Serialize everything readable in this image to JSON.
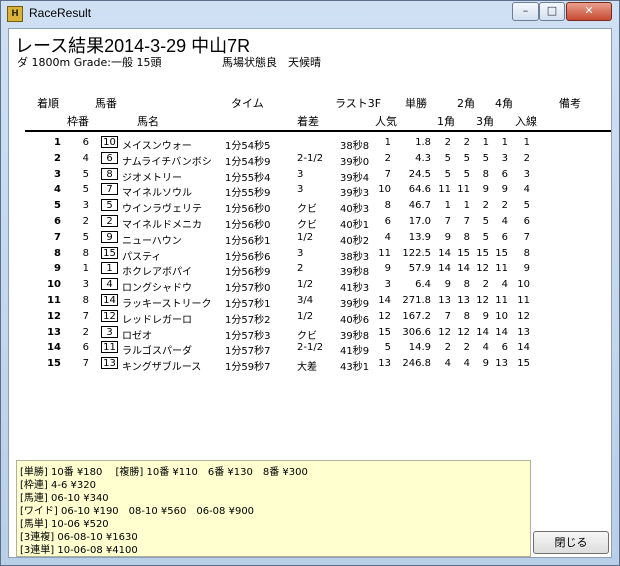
{
  "window": {
    "title": "RaceResult",
    "minimize": "–",
    "maximize": "□",
    "close": "✕"
  },
  "header": {
    "title": "レース結果2014-3-29 中山7R",
    "course": "ダ 1800m Grade:一般 15頭",
    "condition": "馬場状態良　天候晴"
  },
  "columns": {
    "chakujun": "着順",
    "umaban": "馬番",
    "time": "タイム",
    "last3f": "ラスト3F",
    "tansho": "単勝",
    "corner2": "2角",
    "corner4": "4角",
    "biko": "備考",
    "wakuban": "枠番",
    "bamei": "馬名",
    "chakusa": "着差",
    "ninki": "人気",
    "corner1": "1角",
    "corner3": "3角",
    "nyusen": "入線"
  },
  "rows": [
    {
      "pos": "1",
      "waku": "6",
      "num": "10",
      "name": "メイスンウォー",
      "time": "1分54秒5",
      "margin": "",
      "l3f": "38秒8",
      "pop": "1",
      "odds": "1.8",
      "c1": "2",
      "c2": "2",
      "c3": "1",
      "c4": "1",
      "fin": "1"
    },
    {
      "pos": "2",
      "waku": "4",
      "num": "6",
      "name": "ナムライチバンボシ",
      "time": "1分54秒9",
      "margin": "2-1/2",
      "l3f": "39秒0",
      "pop": "2",
      "odds": "4.3",
      "c1": "5",
      "c2": "5",
      "c3": "5",
      "c4": "3",
      "fin": "2"
    },
    {
      "pos": "3",
      "waku": "5",
      "num": "8",
      "name": "ジオメトリー",
      "time": "1分55秒4",
      "margin": "3",
      "l3f": "39秒4",
      "pop": "7",
      "odds": "24.5",
      "c1": "5",
      "c2": "5",
      "c3": "8",
      "c4": "6",
      "fin": "3"
    },
    {
      "pos": "4",
      "waku": "5",
      "num": "7",
      "name": "マイネルソウル",
      "time": "1分55秒9",
      "margin": "3",
      "l3f": "39秒3",
      "pop": "10",
      "odds": "64.6",
      "c1": "11",
      "c2": "11",
      "c3": "9",
      "c4": "9",
      "fin": "4"
    },
    {
      "pos": "5",
      "waku": "3",
      "num": "5",
      "name": "ウインラヴェリテ",
      "time": "1分56秒0",
      "margin": "クビ",
      "l3f": "40秒3",
      "pop": "8",
      "odds": "46.7",
      "c1": "1",
      "c2": "1",
      "c3": "2",
      "c4": "2",
      "fin": "5"
    },
    {
      "pos": "6",
      "waku": "2",
      "num": "2",
      "name": "マイネルドメニカ",
      "time": "1分56秒0",
      "margin": "クビ",
      "l3f": "40秒1",
      "pop": "6",
      "odds": "17.0",
      "c1": "7",
      "c2": "7",
      "c3": "5",
      "c4": "4",
      "fin": "6"
    },
    {
      "pos": "7",
      "waku": "5",
      "num": "9",
      "name": "ニューハウン",
      "time": "1分56秒1",
      "margin": "1/2",
      "l3f": "40秒2",
      "pop": "4",
      "odds": "13.9",
      "c1": "9",
      "c2": "8",
      "c3": "5",
      "c4": "6",
      "fin": "7"
    },
    {
      "pos": "8",
      "waku": "8",
      "num": "15",
      "name": "パスティ",
      "time": "1分56秒6",
      "margin": "3",
      "l3f": "38秒3",
      "pop": "11",
      "odds": "122.5",
      "c1": "14",
      "c2": "15",
      "c3": "15",
      "c4": "15",
      "fin": "8"
    },
    {
      "pos": "9",
      "waku": "1",
      "num": "1",
      "name": "ホクレアボパイ",
      "time": "1分56秒9",
      "margin": "2",
      "l3f": "39秒8",
      "pop": "9",
      "odds": "57.9",
      "c1": "14",
      "c2": "14",
      "c3": "12",
      "c4": "11",
      "fin": "9"
    },
    {
      "pos": "10",
      "waku": "3",
      "num": "4",
      "name": "ロングシャドウ",
      "time": "1分57秒0",
      "margin": "1/2",
      "l3f": "41秒3",
      "pop": "3",
      "odds": "6.4",
      "c1": "9",
      "c2": "8",
      "c3": "2",
      "c4": "4",
      "fin": "10"
    },
    {
      "pos": "11",
      "waku": "8",
      "num": "14",
      "name": "ラッキーストリーク",
      "time": "1分57秒1",
      "margin": "3/4",
      "l3f": "39秒9",
      "pop": "14",
      "odds": "271.8",
      "c1": "13",
      "c2": "13",
      "c3": "12",
      "c4": "11",
      "fin": "11"
    },
    {
      "pos": "12",
      "waku": "7",
      "num": "12",
      "name": "レッドレガーロ",
      "time": "1分57秒2",
      "margin": "1/2",
      "l3f": "40秒6",
      "pop": "12",
      "odds": "167.2",
      "c1": "7",
      "c2": "8",
      "c3": "9",
      "c4": "10",
      "fin": "12"
    },
    {
      "pos": "13",
      "waku": "2",
      "num": "3",
      "name": "ロゼオ",
      "time": "1分57秒3",
      "margin": "クビ",
      "l3f": "39秒8",
      "pop": "15",
      "odds": "306.6",
      "c1": "12",
      "c2": "12",
      "c3": "14",
      "c4": "14",
      "fin": "13"
    },
    {
      "pos": "14",
      "waku": "6",
      "num": "11",
      "name": "ラルゴスパーダ",
      "time": "1分57秒7",
      "margin": "2-1/2",
      "l3f": "41秒9",
      "pop": "5",
      "odds": "14.9",
      "c1": "2",
      "c2": "2",
      "c3": "4",
      "c4": "6",
      "fin": "14"
    },
    {
      "pos": "15",
      "waku": "7",
      "num": "13",
      "name": "キングザブルース",
      "time": "1分59秒7",
      "margin": "大差",
      "l3f": "43秒1",
      "pop": "13",
      "odds": "246.8",
      "c1": "4",
      "c2": "4",
      "c3": "9",
      "c4": "13",
      "fin": "15"
    }
  ],
  "payouts": [
    "[単勝] 10番 ¥180　 [複勝] 10番 ¥110　6番 ¥130　8番 ¥300",
    "[枠連] 4-6 ¥320",
    "[馬連] 06-10 ¥340",
    "[ワイド] 06-10 ¥190　08-10 ¥560　06-08 ¥900",
    "[馬単] 10-06 ¥520",
    "[3連複] 06-08-10 ¥1630",
    "[3連単] 10-06-08 ¥4100"
  ],
  "close_button": "閉じる"
}
